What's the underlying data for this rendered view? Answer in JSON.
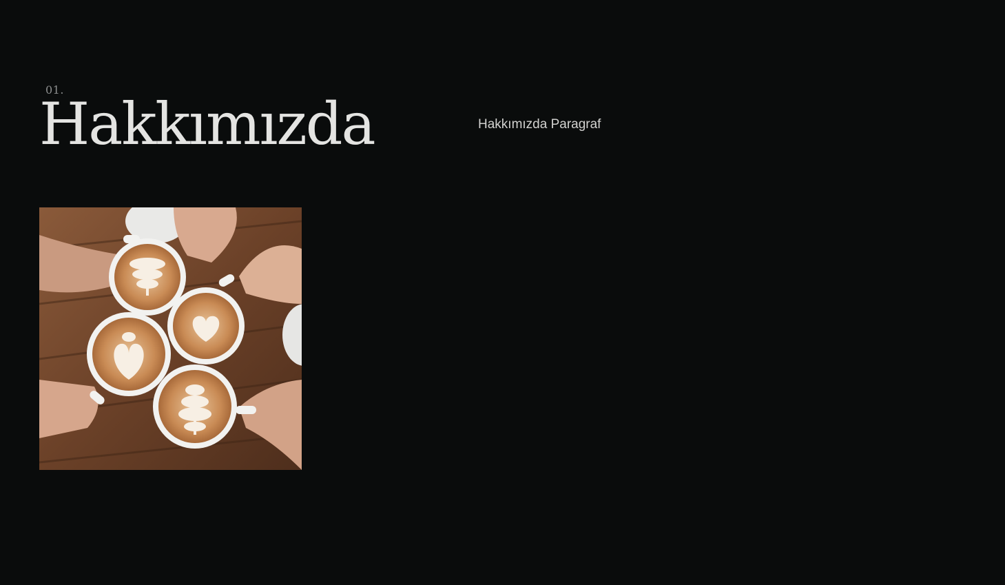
{
  "about": {
    "number": "01.",
    "title": "Hakkımızda",
    "paragraph": "Hakkımızda Paragraf"
  },
  "image": {
    "alt": "Latte art coffee cups held together over a wooden table"
  },
  "colors": {
    "background": "#0a0c0c",
    "title": "#e4e4e2",
    "number": "#8d8f8f",
    "paragraph": "#d2d2d0"
  }
}
